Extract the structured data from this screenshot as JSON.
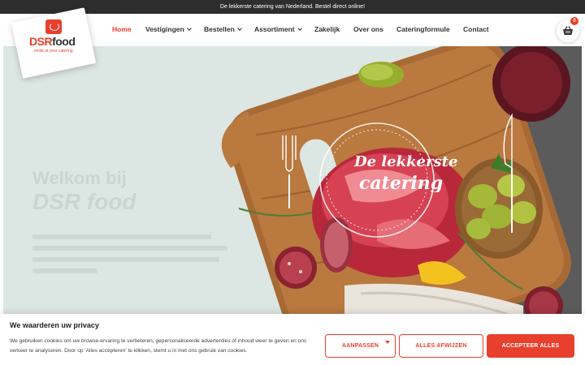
{
  "topbar": {
    "text": "De lekkerste catering van Nederland. Bestel direct online!"
  },
  "logo": {
    "brand_part1": "DSR",
    "brand_part2": "food",
    "tagline": "smile at your catering"
  },
  "nav": {
    "items": [
      {
        "label": "Home",
        "active": true,
        "dropdown": false
      },
      {
        "label": "Vestigingen",
        "active": false,
        "dropdown": true
      },
      {
        "label": "Bestellen",
        "active": false,
        "dropdown": true
      },
      {
        "label": "Assortiment",
        "active": false,
        "dropdown": true
      },
      {
        "label": "Zakelijk",
        "active": false,
        "dropdown": false
      },
      {
        "label": "Over ons",
        "active": false,
        "dropdown": false
      },
      {
        "label": "Cateringformule",
        "active": false,
        "dropdown": false
      }
    ],
    "contact": "Contact"
  },
  "cart": {
    "count": "0",
    "icon": "basket-icon"
  },
  "hero": {
    "overlay_title1": "De lekkerste",
    "overlay_title2": "catering",
    "faded_title1": "Welkom bij",
    "faded_title2": "DSR food"
  },
  "cookie": {
    "title": "We waarderen uw privacy",
    "text": "We gebruiken cookies om uw browse-ervaring te verbeteren, gepersonaliseerde advertenties of inhoud weer te geven en ons verkeer te analyseren. Door op 'Alles accepteren' te klikken, stemt u in met ons gebruik van cookies.",
    "customize": "AANPASSEN",
    "reject": "ALLES AFWIJZEN",
    "accept": "ACCEPTEER ALLES"
  },
  "colors": {
    "accent": "#e8402d",
    "topbar": "#2d2d2d",
    "hero_bg": "#dbe5e1"
  }
}
